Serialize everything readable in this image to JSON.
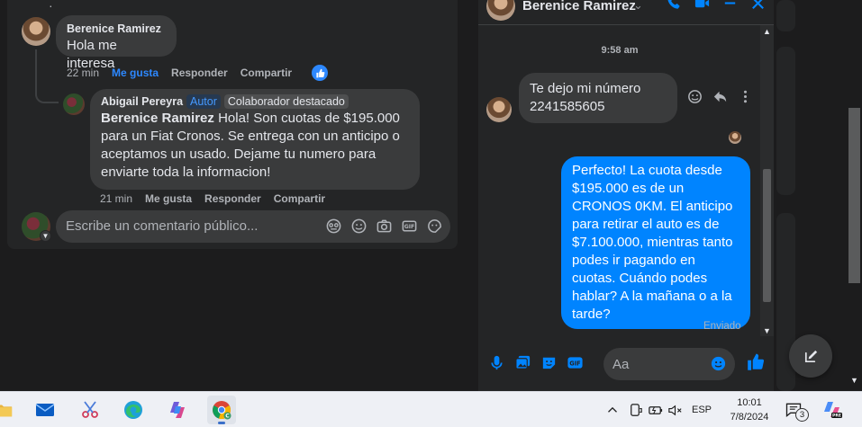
{
  "post_comments": {
    "root_comment": {
      "author": "Berenice Ramirez",
      "text": "Hola me interesa",
      "time": "22 min",
      "like_label": "Me gusta",
      "reply_label": "Responder",
      "share_label": "Compartir"
    },
    "reply": {
      "author": "Abigail Pereyra",
      "badge_author": "Autor",
      "badge_contributor": "Colaborador destacado",
      "mention": "Berenice Ramirez",
      "text": " Hola! Son cuotas de $195.000 para un Fiat Cronos. Se entrega con un anticipo o aceptamos un usado. Dejame tu numero para enviarte toda la informacion!",
      "time": "21 min",
      "like_label": "Me gusta",
      "reply_label": "Responder",
      "share_label": "Compartir"
    },
    "composer_placeholder": "Escribe un comentario público..."
  },
  "chat": {
    "contact_name": "Berenice Ramirez",
    "timestamp": "9:58 am",
    "incoming_message": "Te dejo mi número 2241585605",
    "outgoing_message": "Perfecto! La cuota desde $195.000 es de un CRONOS 0KM. El anticipo para retirar el auto es de $7.100.000, mientras tanto podes ir pagando en cuotas. Cuándo podes hablar? A la mañana o a la tarde?",
    "status": "Enviado",
    "input_placeholder": "Aa"
  },
  "taskbar": {
    "language": "ESP",
    "time": "10:01",
    "date": "7/8/2024",
    "notification_count": "3"
  },
  "colors": {
    "accent_blue": "#0084ff",
    "like_blue": "#2d88ff",
    "author_badge": "#4599ff",
    "background": "#1c1c1d",
    "surface": "#242526",
    "bubble": "#3a3b3c"
  }
}
